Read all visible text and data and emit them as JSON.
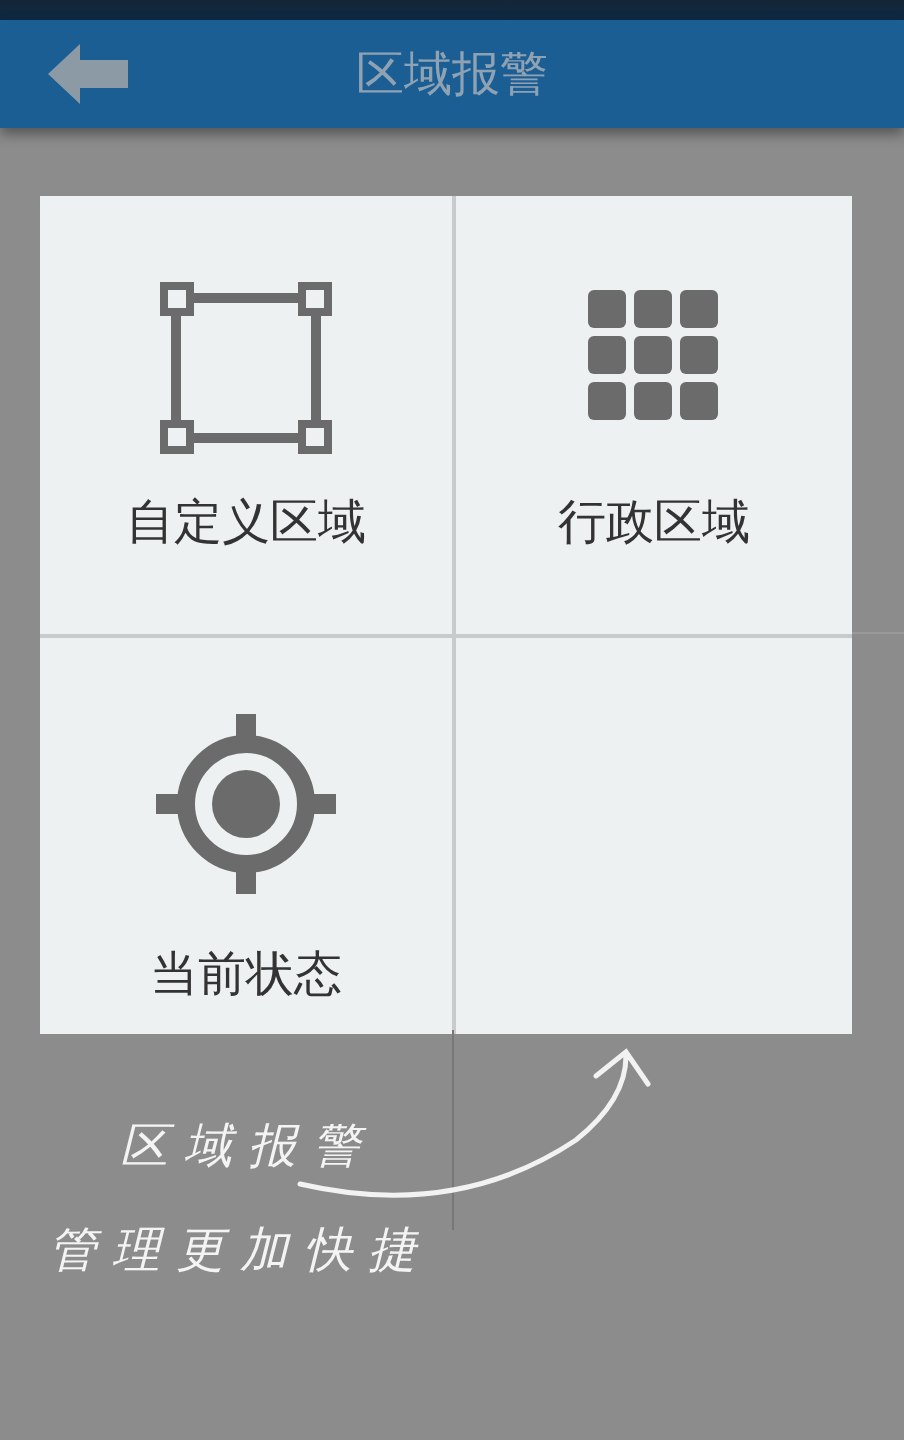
{
  "header": {
    "title": "区域报警"
  },
  "tiles": [
    {
      "kind": "custom",
      "label": "自定义区域"
    },
    {
      "kind": "admin",
      "label": "行政区域"
    },
    {
      "kind": "status",
      "label": "当前状态"
    },
    {
      "kind": "empty"
    }
  ],
  "hint": {
    "lines": [
      "区域报警",
      "管理更加快捷"
    ]
  }
}
